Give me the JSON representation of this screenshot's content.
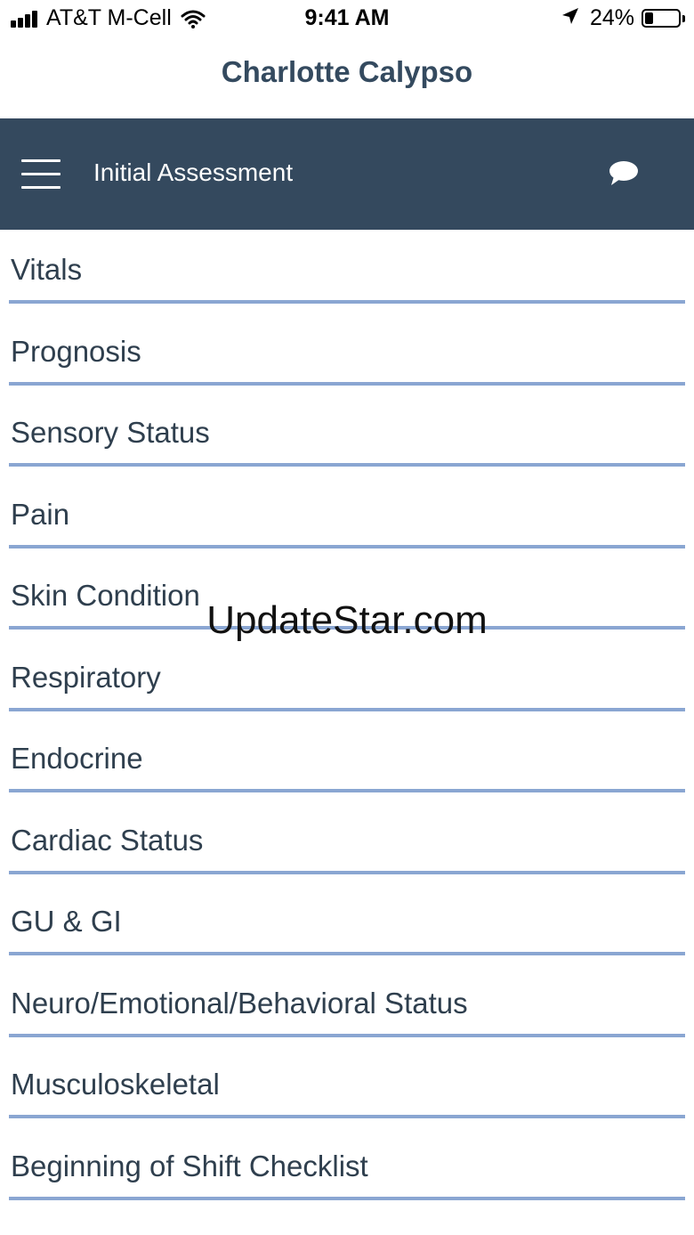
{
  "status_bar": {
    "carrier": "AT&T M-Cell",
    "time": "9:41 AM",
    "battery_percent": "24%",
    "battery_level": 0.24,
    "signal_bars": 4
  },
  "header": {
    "patient_name": "Charlotte Calypso"
  },
  "toolbar": {
    "title": "Initial Assessment",
    "background": "#34495e"
  },
  "menu": {
    "items": [
      {
        "label": "Vitals"
      },
      {
        "label": "Prognosis"
      },
      {
        "label": "Sensory Status"
      },
      {
        "label": "Pain"
      },
      {
        "label": "Skin Condition"
      },
      {
        "label": "Respiratory"
      },
      {
        "label": "Endocrine"
      },
      {
        "label": "Cardiac Status"
      },
      {
        "label": "GU & GI"
      },
      {
        "label": "Neuro/Emotional/Behavioral Status"
      },
      {
        "label": "Musculoskeletal"
      },
      {
        "label": "Beginning of Shift Checklist"
      }
    ],
    "divider_color": "#8aa6d2"
  },
  "watermark": {
    "text": "UpdateStar.com"
  }
}
